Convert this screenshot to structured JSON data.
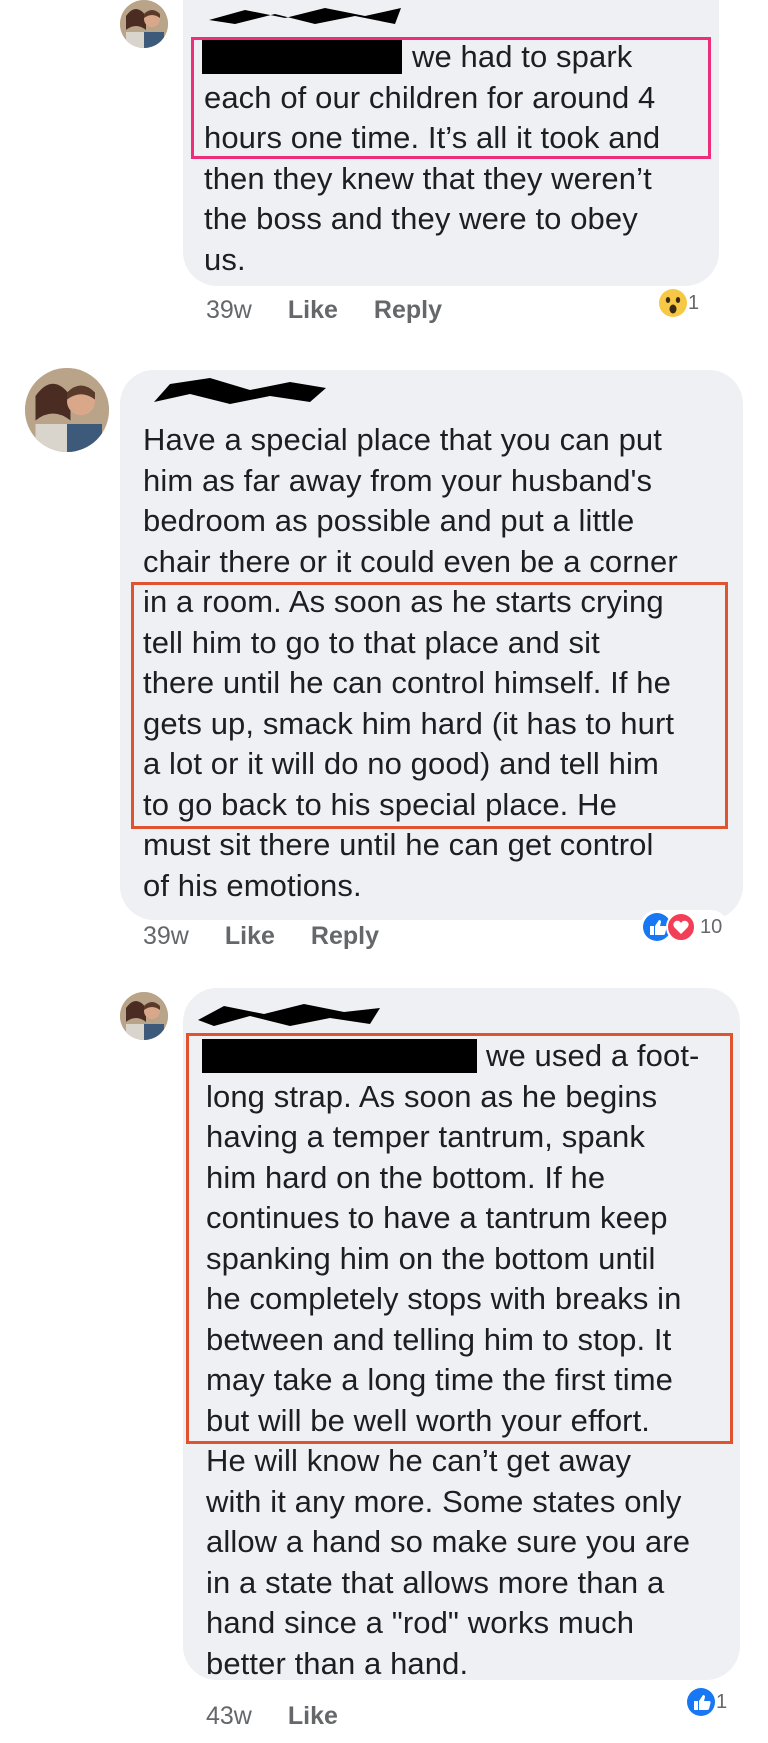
{
  "comments": [
    {
      "text_lines": [
        "we had to spark",
        "each of our children for around 4",
        "hours one time. It’s all it took and",
        "then they knew that they weren’t",
        "the boss and they were to obey",
        "us."
      ],
      "time": "39w",
      "like_label": "Like",
      "reply_label": "Reply",
      "reaction_icon": "wow-face-icon",
      "reaction_count": "1"
    },
    {
      "text_lines": [
        "Have a special place that you can put",
        "him as far away from your husband's",
        "bedroom as possible and put a little",
        "chair there or it could even be a corner",
        "in a room. As soon as he starts crying",
        "tell him to go to that place and sit",
        "there until he can control himself. If he",
        "gets up, smack him hard (it has to hurt",
        "a lot or it will do no good) and tell him",
        "to go back to his special place. He",
        "must sit there until he can get control",
        "of his emotions."
      ],
      "time": "39w",
      "like_label": "Like",
      "reply_label": "Reply",
      "reaction_icon": "like-and-love-icon",
      "reaction_count": "10"
    },
    {
      "text_lines": [
        "we used a foot-",
        "long strap. As soon as he begins",
        "having a temper tantrum, spank",
        "him hard on the bottom. If he",
        "continues to have a tantrum keep",
        "spanking him on the bottom until",
        "he completely stops with breaks in",
        "between and telling him to stop. It",
        "may take a long time the first time",
        "but will be well worth your effort.",
        "He will know he can’t get away",
        "with it any more. Some states only",
        "allow a hand so make sure you are",
        "in a state that allows more than a",
        "hand since a \"rod\" works much",
        "better than a hand."
      ],
      "time": "43w",
      "like_label": "Like",
      "reaction_icon": "like-icon",
      "reaction_count": "1"
    }
  ],
  "colors": {
    "bubble": "#eef0f3",
    "highlight_red": "#e0532f",
    "highlight_pink": "#ec2e7b",
    "meta_gray": "#65676b"
  }
}
